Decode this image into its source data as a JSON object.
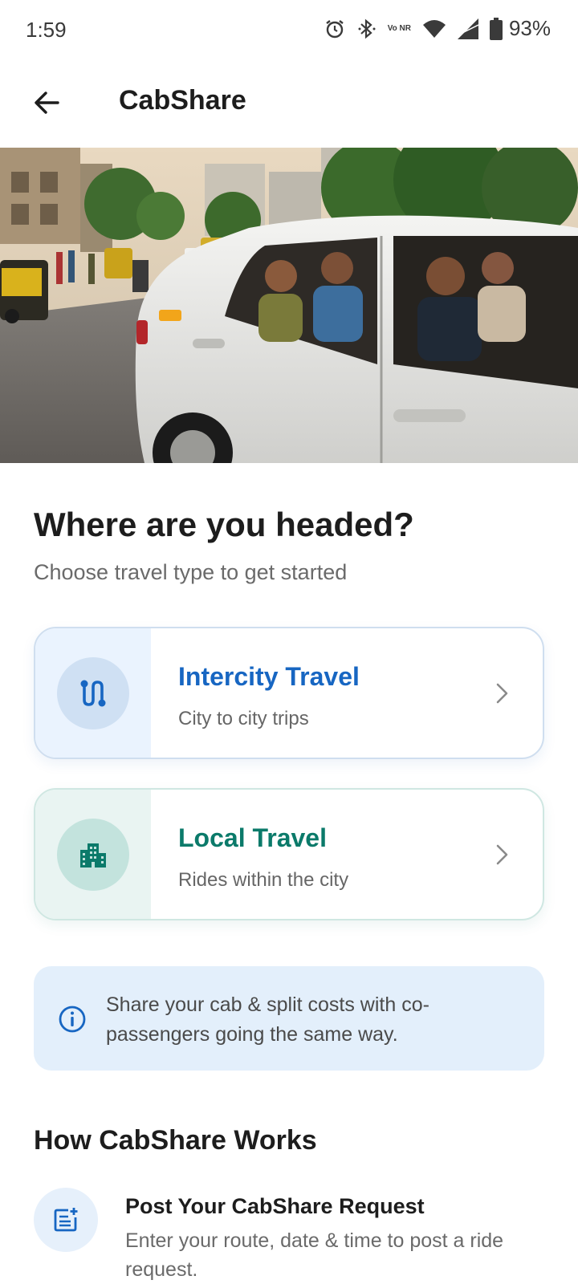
{
  "status_bar": {
    "time": "1:59",
    "battery": "93%",
    "network_label": "Vo NR",
    "icons": [
      "alarm-icon",
      "bluetooth-icon",
      "vonr-icon",
      "wifi-icon",
      "signal-icon",
      "battery-icon"
    ]
  },
  "app_bar": {
    "title": "CabShare",
    "back_icon": "arrow-left-icon"
  },
  "hero": {
    "image": "photo-white-taxi-with-passengers-on-city-street"
  },
  "main": {
    "headline": "Where are you headed?",
    "subline": "Choose travel type to get started",
    "options": [
      {
        "title": "Intercity Travel",
        "description": "City to city trips",
        "icon": "route-icon",
        "accent": "#1766c2"
      },
      {
        "title": "Local Travel",
        "description": "Rides within the city",
        "icon": "city-buildings-icon",
        "accent": "#0b7a6a"
      }
    ],
    "info": {
      "icon": "info-icon",
      "text": "Share your cab & split costs with co-passengers going the same way."
    }
  },
  "how_it_works": {
    "title": "How CabShare Works",
    "steps": [
      {
        "icon": "post-add-icon",
        "title": "Post Your CabShare Request",
        "description": "Enter your route, date & time to post a ride request."
      }
    ]
  },
  "colors": {
    "primary_blue": "#1766c2",
    "teal": "#0b7a6a",
    "info_bg": "#e3effb"
  }
}
